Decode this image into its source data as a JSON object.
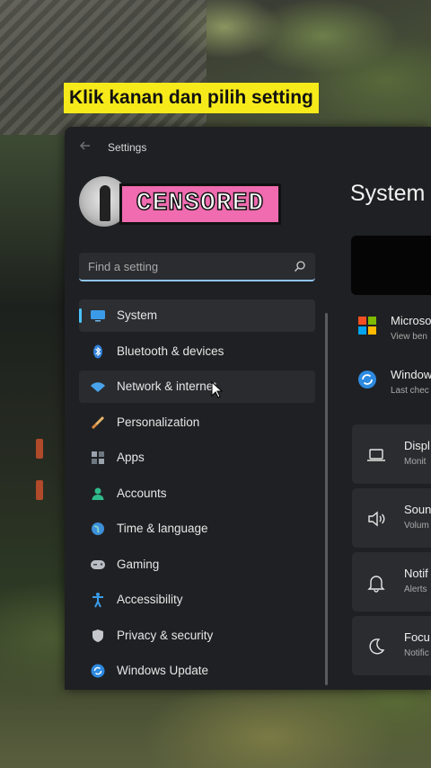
{
  "caption": "Klik kanan dan pilih setting",
  "window": {
    "title": "Settings",
    "profile": {
      "censor_label": "CENSORED"
    },
    "search": {
      "placeholder": "Find a setting"
    },
    "sidebar": {
      "items": [
        {
          "label": "System",
          "icon": "system-icon",
          "selected": true
        },
        {
          "label": "Bluetooth & devices",
          "icon": "bluetooth-icon"
        },
        {
          "label": "Network & internet",
          "icon": "network-icon",
          "hover": true
        },
        {
          "label": "Personalization",
          "icon": "brush-icon"
        },
        {
          "label": "Apps",
          "icon": "apps-icon"
        },
        {
          "label": "Accounts",
          "icon": "accounts-icon"
        },
        {
          "label": "Time & language",
          "icon": "globe-icon"
        },
        {
          "label": "Gaming",
          "icon": "gamepad-icon"
        },
        {
          "label": "Accessibility",
          "icon": "accessibility-icon"
        },
        {
          "label": "Privacy & security",
          "icon": "shield-icon"
        },
        {
          "label": "Windows Update",
          "icon": "update-icon"
        }
      ]
    },
    "main": {
      "title": "System",
      "info_rows": [
        {
          "title": "Microso",
          "subtitle": "View ben",
          "icon": "microsoft-logo-icon"
        },
        {
          "title": "Window",
          "subtitle": "Last chec",
          "icon": "windows-update-icon"
        }
      ],
      "cards": [
        {
          "title": "Displ",
          "subtitle": "Monit",
          "icon": "laptop-icon"
        },
        {
          "title": "Soun",
          "subtitle": "Volum",
          "icon": "speaker-icon"
        },
        {
          "title": "Notif",
          "subtitle": "Alerts",
          "icon": "bell-icon"
        },
        {
          "title": "Focu",
          "subtitle": "Notific",
          "icon": "moon-icon"
        }
      ]
    }
  },
  "colors": {
    "caption_bg": "#f7ea1a",
    "accent": "#4cc2ff",
    "window_bg": "#1f2023",
    "censor_bg": "#f06bb0"
  }
}
